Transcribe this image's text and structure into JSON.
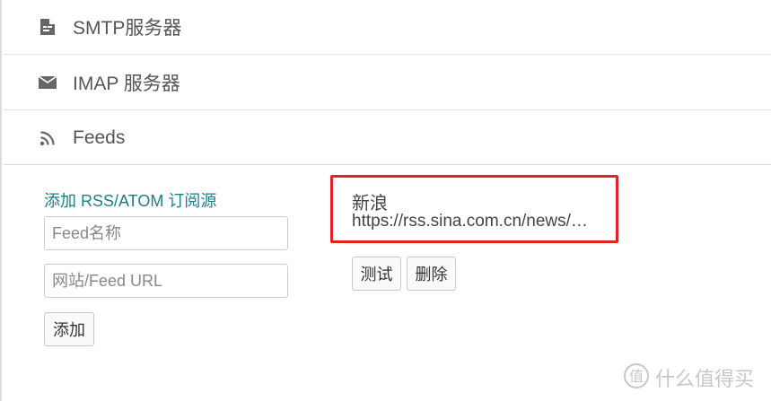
{
  "sections": {
    "smtp": {
      "label": "SMTP服务器",
      "icon": "document-icon"
    },
    "imap": {
      "label": "IMAP 服务器",
      "icon": "envelope-icon"
    },
    "feeds": {
      "label": "Feeds",
      "icon": "rss-icon"
    }
  },
  "add_form": {
    "title": "添加 RSS/ATOM 订阅源",
    "name_placeholder": "Feed名称",
    "url_placeholder": "网站/Feed URL",
    "add_label": "添加"
  },
  "feed_item": {
    "name": "新浪",
    "url": "https://rss.sina.com.cn/news/…",
    "test_label": "测试",
    "delete_label": "删除"
  },
  "watermark": {
    "text": "什么值得买",
    "icon": "zhi-icon"
  },
  "colors": {
    "accent": "#1a7f86",
    "highlight": "#e02424",
    "text": "#555555",
    "border": "#cccccc"
  }
}
